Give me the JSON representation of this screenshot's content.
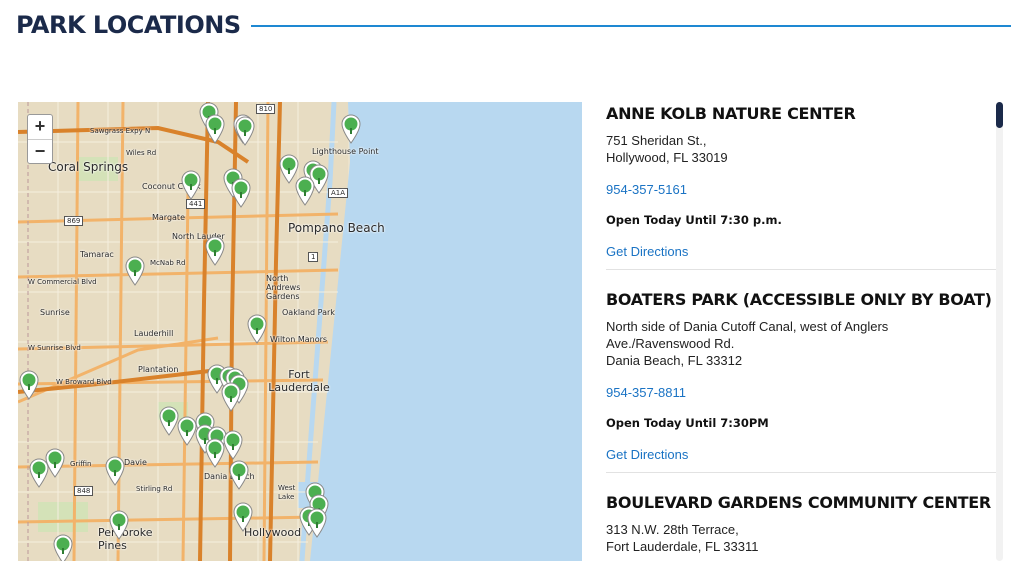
{
  "header": {
    "title": "PARK LOCATIONS"
  },
  "map": {
    "zoom_in": "+",
    "zoom_out": "−",
    "labels": {
      "coral_springs": "Coral Springs",
      "sawgrass": "Sawgrass Expy N",
      "wiles": "Wiles Rd",
      "coconut_creek": "Coconut Creek",
      "lighthouse_point": "Lighthouse Point",
      "margate": "Margate",
      "north_lauderdale": "North Lauder",
      "pompano_beach": "Pompano Beach",
      "tamarac": "Tamarac",
      "mcnab": "McNab Rd",
      "commercial": "W Commercial Blvd",
      "north_andrews": "North Andrews Gardens",
      "sunrise": "Sunrise",
      "oakland_park": "Oakland Park",
      "lauderhill": "Lauderhill",
      "wilton_manors": "Wilton Manors",
      "w_sunrise": "W Sunrise Blvd",
      "plantation": "Plantation",
      "fort_lauderdale": "Fort Lauderdale",
      "broward": "W Broward Blvd",
      "davie": "Davie",
      "griffin": "Griffin",
      "dania_beach": "Dania Beach",
      "stirling": "Stirling Rd",
      "west_lake": "West Lake",
      "pembroke_pines": "Pembroke Pines",
      "hollywood": "Hollywood",
      "a1a": "A1A",
      "r441": "441",
      "r810": "810",
      "r869": "869",
      "r848": "848",
      "r1": "1"
    }
  },
  "parks": [
    {
      "name": "ANNE KOLB NATURE CENTER",
      "address": [
        "751 Sheridan St.,",
        "Hollywood, FL 33019"
      ],
      "phone": "954-357-5161",
      "hours": "Open Today Until 7:30 p.m.",
      "directions": "Get Directions"
    },
    {
      "name": "BOATERS PARK (ACCESSIBLE ONLY BY BOAT)",
      "address": [
        "North side of Dania Cutoff Canal, west of Anglers",
        "Ave./Ravenswood Rd.",
        "Dania Beach, FL 33312"
      ],
      "phone": "954-357-8811",
      "hours": "Open Today Until 7:30PM",
      "directions": "Get Directions"
    },
    {
      "name": "BOULEVARD GARDENS COMMUNITY CENTER",
      "address": [
        "313 N.W. 28th Terrace,",
        "Fort Lauderdale, FL 33311"
      ],
      "phone": "",
      "hours": "",
      "directions": ""
    }
  ],
  "colors": {
    "title": "#1b2a4a",
    "rule": "#1e88d2",
    "link": "#1a73c4",
    "pin": "#4caf50",
    "water": "#b8d8f0"
  },
  "icons": {
    "pin": "map-pin-icon"
  }
}
